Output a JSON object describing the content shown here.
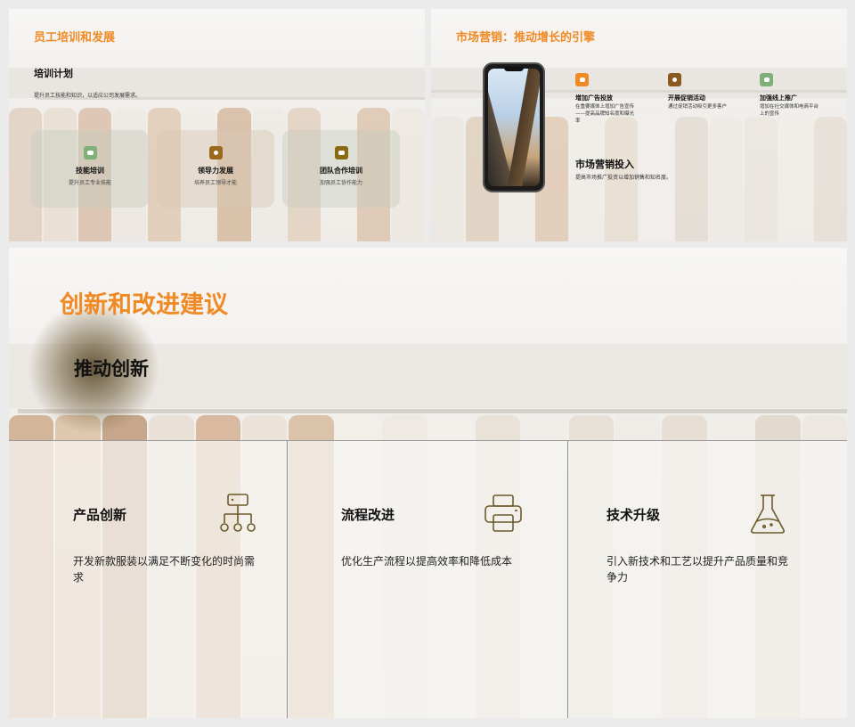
{
  "slide1": {
    "title": "员工培训和发展",
    "heading": "培训计划",
    "description": "提升员工技能和知识，以适应公司发展需求。",
    "cards": [
      {
        "title": "技能培训",
        "desc": "提升员工专业技能",
        "icon": "message-icon",
        "color": "#7fb07a"
      },
      {
        "title": "领导力发展",
        "desc": "培养员工领导才能",
        "icon": "target-icon",
        "color": "#9a6a1f"
      },
      {
        "title": "团队合作培训",
        "desc": "加强员工协作能力",
        "icon": "chat-icon",
        "color": "#8a6a12"
      }
    ]
  },
  "slide2": {
    "title": "市场营销：推动增长的引擎",
    "items": [
      {
        "title": "增加广告投放",
        "desc": "在重要媒体上增加广告宣传——提高品牌知名度和曝光率",
        "icon": "bed-icon",
        "color": "#f08a24"
      },
      {
        "title": "开展促销活动",
        "desc": "通过促销活动吸引更多客户",
        "icon": "target-icon",
        "color": "#8a5a1e"
      },
      {
        "title": "加强线上推广",
        "desc": "增加在社交媒体和电商平台上的宣传",
        "icon": "chat-icon",
        "color": "#7fb07a"
      }
    ],
    "heading": "市场营销投入",
    "heading_desc": "提高市场推广投资以增加销售和知名度。"
  },
  "slide3": {
    "title": "创新和改进建议",
    "heading": "推动创新",
    "columns": [
      {
        "title": "产品创新",
        "desc": "开发新款服装以满足不断变化的时尚需求",
        "icon": "org-chart-icon"
      },
      {
        "title": "流程改进",
        "desc": "优化生产流程以提高效率和降低成本",
        "icon": "printer-icon"
      },
      {
        "title": "技术升级",
        "desc": "引入新技术和工艺以提升产品质量和竞争力",
        "icon": "flask-icon"
      }
    ],
    "icon_color": "#6b5a2a"
  }
}
